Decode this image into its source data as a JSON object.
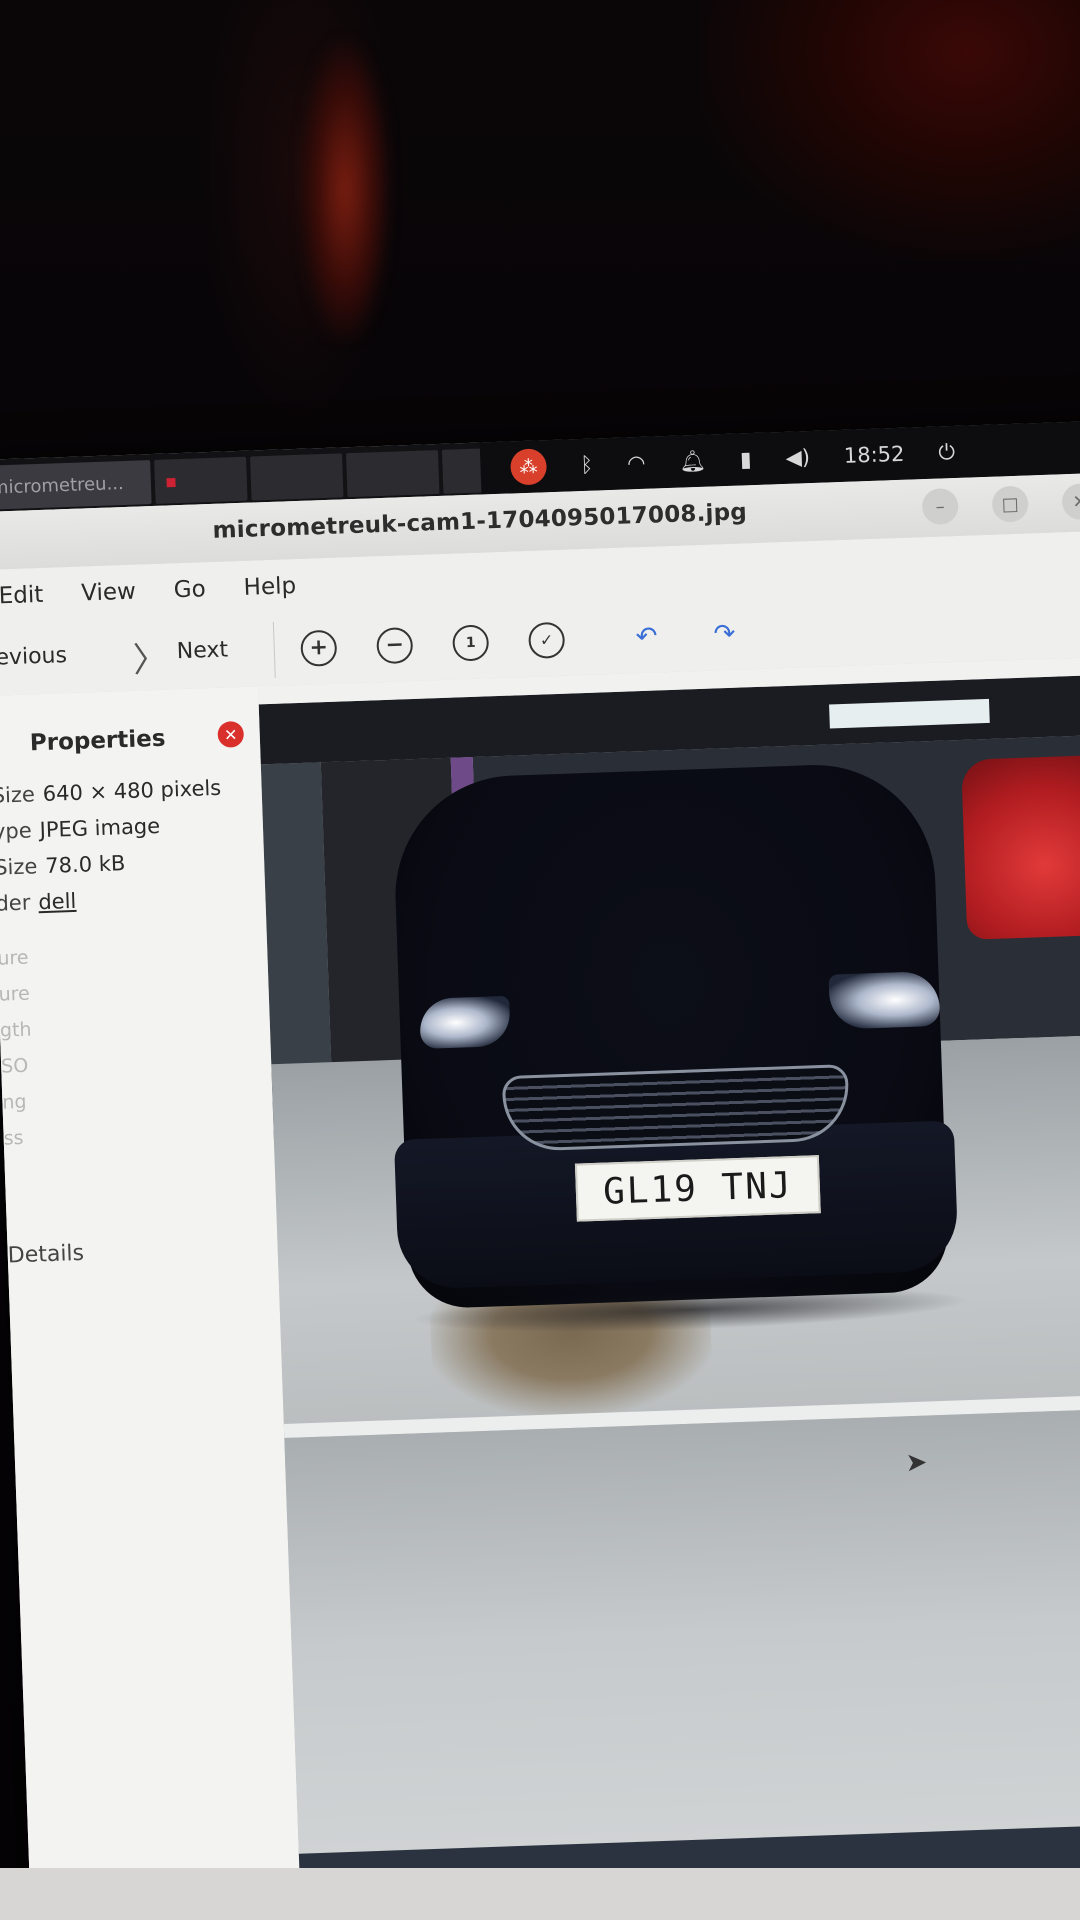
{
  "taskbar": {
    "active_item": "micrometreu...",
    "clock": "18:52"
  },
  "window": {
    "title": "micrometreuk-cam1-1704095017008.jpg"
  },
  "menubar": {
    "items": [
      "Edit",
      "View",
      "Go",
      "Help"
    ]
  },
  "toolbar": {
    "previous_label": "revious",
    "next_label": "Next",
    "zoom_in_icon": "zoom-in-icon",
    "zoom_out_icon": "zoom-out-icon",
    "zoom_normal_icon": "zoom-normal-icon",
    "zoom_fit_icon": "zoom-fit-icon",
    "rotate_left_icon": "rotate-left-icon",
    "rotate_right_icon": "rotate-right-icon"
  },
  "properties": {
    "header": "Properties",
    "rows": [
      {
        "key": "Size",
        "value": "640 × 480 pixels"
      },
      {
        "key": "ype",
        "value": "JPEG image"
      },
      {
        "key": "Size",
        "value": "78.0 kB"
      },
      {
        "key": "der",
        "value": "dell"
      }
    ],
    "faded_rows": [
      "ure",
      "ure",
      "gth",
      "SO",
      "ng",
      "ss",
      "",
      ""
    ],
    "details_label": "Details"
  },
  "photo": {
    "plate_text": "GL19 TNJ"
  },
  "colors": {
    "close_badge": "#d9302c",
    "topbar": "#121215",
    "ubuntu_badge": "#d8402b"
  }
}
